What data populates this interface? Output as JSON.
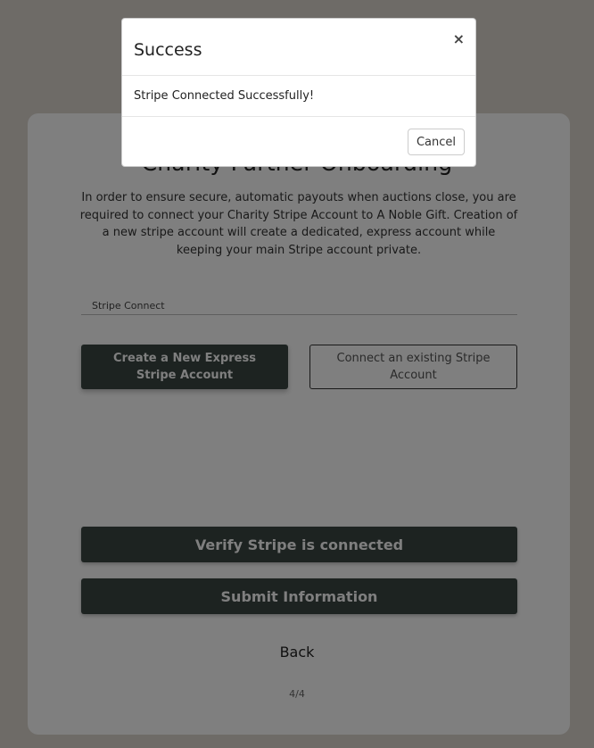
{
  "page": {
    "title": "Charity Partner Onboarding",
    "intro": "In order to ensure secure, automatic payouts when auctions close, you are required to connect your Charity Stripe Account to A Noble Gift. Creation of a new stripe account will create a dedicated, express account while keeping your main Stripe account private.",
    "field_label": "Stripe Connect",
    "create_button": "Create a New Express Stripe Account",
    "existing_button": "Connect an existing Stripe Account",
    "verify_button": "Verify Stripe is connected",
    "submit_button": "Submit Information",
    "back_link": "Back",
    "step": "4/4"
  },
  "modal": {
    "title": "Success",
    "close_glyph": "×",
    "message": "Stripe Connected Successfully!",
    "cancel_button": "Cancel"
  },
  "colors": {
    "page_background": "#ddd6cf",
    "dark_button": "#3a4642",
    "overlay": "rgba(0,0,0,0.5)"
  }
}
